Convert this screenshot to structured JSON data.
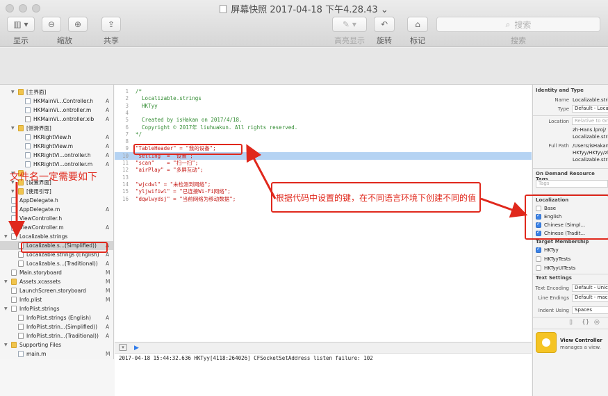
{
  "window": {
    "title": "屏幕快照 2017-04-18 下午4.28.43",
    "title_chevron": "⌄"
  },
  "toolbar": {
    "view_label": "显示",
    "zoom_label": "缩放",
    "share_label": "共享",
    "markup_label": "高亮显示",
    "rotate_label": "旋转",
    "tag_label": "标记",
    "search_label": "搜索",
    "search_placeholder": "搜索"
  },
  "navigator": {
    "rows": [
      {
        "label": "[主界面]",
        "badge": "",
        "kind": "folder",
        "indent": 2
      },
      {
        "label": "HKMainVi...Controller.h",
        "badge": "A",
        "kind": "h",
        "indent": 3
      },
      {
        "label": "HKMainVi...ontroller.m",
        "badge": "A",
        "kind": "m",
        "indent": 3
      },
      {
        "label": "HKMainVi...ontroller.xib",
        "badge": "A",
        "kind": "xib",
        "indent": 3
      },
      {
        "label": "[侧滑界面]",
        "badge": "",
        "kind": "folder",
        "indent": 2
      },
      {
        "label": "HKRightView.h",
        "badge": "A",
        "kind": "h",
        "indent": 3
      },
      {
        "label": "HKRightView.m",
        "badge": "A",
        "kind": "m",
        "indent": 3
      },
      {
        "label": "HKRightVi...ontroller.h",
        "badge": "A",
        "kind": "h",
        "indent": 3
      },
      {
        "label": "HKRightVi...ontroller.m",
        "badge": "A",
        "kind": "m",
        "indent": 3
      },
      {
        "label": "",
        "badge": "",
        "kind": "folder",
        "indent": 2
      },
      {
        "label": "[设置界面]",
        "badge": "",
        "kind": "folder",
        "indent": 2
      },
      {
        "label": "[使用引导]",
        "badge": "",
        "kind": "folder",
        "indent": 2
      },
      {
        "label": "AppDelegate.h",
        "badge": "",
        "kind": "h",
        "indent": 1
      },
      {
        "label": "AppDelegate.m",
        "badge": "A",
        "kind": "m",
        "indent": 1
      },
      {
        "label": "ViewController.h",
        "badge": "",
        "kind": "h",
        "indent": 1
      },
      {
        "label": "ViewController.m",
        "badge": "A",
        "kind": "m",
        "indent": 1
      },
      {
        "label": "Localizable.strings",
        "badge": "",
        "kind": "strings",
        "indent": 1
      },
      {
        "label": "Localizable.s...(Simplified))",
        "badge": "A",
        "kind": "strings",
        "indent": 2
      },
      {
        "label": "Localizable.strings (English)",
        "badge": "A",
        "kind": "strings",
        "indent": 2
      },
      {
        "label": "Localizable.s...(Traditional))",
        "badge": "A",
        "kind": "strings",
        "indent": 2
      },
      {
        "label": "Main.storyboard",
        "badge": "M",
        "kind": "storyboard",
        "indent": 1
      },
      {
        "label": "Assets.xcassets",
        "badge": "M",
        "kind": "folder",
        "indent": 1
      },
      {
        "label": "LaunchScreen.storyboard",
        "badge": "M",
        "kind": "storyboard",
        "indent": 1
      },
      {
        "label": "Info.plist",
        "badge": "M",
        "kind": "plist",
        "indent": 1
      },
      {
        "label": "InfoPlist.strings",
        "badge": "",
        "kind": "strings",
        "indent": 1
      },
      {
        "label": "InfoPlist.strings (English)",
        "badge": "A",
        "kind": "strings",
        "indent": 2
      },
      {
        "label": "InfoPlist.strin...(Simplified))",
        "badge": "A",
        "kind": "strings",
        "indent": 2
      },
      {
        "label": "InfoPlist.strin...(Traditional))",
        "badge": "A",
        "kind": "strings",
        "indent": 2
      },
      {
        "label": "Supporting Files",
        "badge": "",
        "kind": "folder",
        "indent": 1
      },
      {
        "label": "main.m",
        "badge": "M",
        "kind": "m",
        "indent": 2
      }
    ]
  },
  "editor": {
    "lines": [
      {
        "n": "1",
        "text": "/*",
        "style": "comment"
      },
      {
        "n": "2",
        "text": "  Localizable.strings",
        "style": "comment"
      },
      {
        "n": "3",
        "text": "  HKTyy",
        "style": "comment"
      },
      {
        "n": "4",
        "text": "",
        "style": "comment"
      },
      {
        "n": "5",
        "text": "  Created by isHakan on 2017/4/18.",
        "style": "comment"
      },
      {
        "n": "6",
        "text": "  Copyright © 2017年 liuhuakun. All rights reserved.",
        "style": "comment"
      },
      {
        "n": "7",
        "text": "*/",
        "style": "comment"
      },
      {
        "n": "8",
        "text": "",
        "style": "plain"
      },
      {
        "n": "9",
        "text": "\"TableHeader\" = \"我的设备\";",
        "style": "str"
      },
      {
        "n": "10",
        "text": "\"setting\" = \"设置\";",
        "style": "str"
      },
      {
        "n": "11",
        "text": "\"scan\"    = \"扫一扫\";",
        "style": "str"
      },
      {
        "n": "12",
        "text": "\"airPlay\" = \"多屏互动\";",
        "style": "str"
      },
      {
        "n": "13",
        "text": "",
        "style": "plain"
      },
      {
        "n": "14",
        "text": "\"wjcdwl\" = \"未检测到网络\";",
        "style": "str"
      },
      {
        "n": "15",
        "text": "\"yljwifiwl\" = \"已连接Wi-Fi网络\";",
        "style": "str"
      },
      {
        "n": "16",
        "text": "\"dqwlwydsj\" = \"当前网络为移动数据\";",
        "style": "str"
      }
    ]
  },
  "console": {
    "text": "2017-04-18 15:44:32.636 HKTyy[4118:264026] CFSocketSetAddress listen failure: 102"
  },
  "inspector": {
    "identity_title": "Identity and Type",
    "name_key": "Name",
    "name_val": "Localizable.strings",
    "type_key": "Type",
    "type_val": "Default - Localizable",
    "location_key": "Location",
    "location_val": "Relative to Group",
    "location_path1": "zh-Hans.lproj/",
    "location_path2": "Localizable.strings",
    "fullpath_key": "Full Path",
    "fullpath_1": "/Users/isHakan/",
    "fullpath_2": "HKTyy/HKTyy/zh-",
    "fullpath_3": "Localizable.strings",
    "odr_title": "On Demand Resource Tags",
    "tags_placeholder": "Tags",
    "localization_title": "Localization",
    "loc_base": "Base",
    "loc_english": "English",
    "loc_simplified": "Chinese (Simpl...",
    "loc_traditional": "Chinese (Tradit...",
    "target_title": "Target Membership",
    "target_1": "HKTyy",
    "target_2": "HKTyyTests",
    "target_3": "HKTyyUITests",
    "text_settings_title": "Text Settings",
    "encoding_key": "Text Encoding",
    "encoding_val": "Default - Unicode",
    "endings_key": "Line Endings",
    "endings_val": "Default - macOS",
    "indent_key": "Indent Using",
    "indent_val": "Spaces",
    "lib_title": "View Controller",
    "lib_desc": "manages a view."
  },
  "annotations": {
    "side_note": "文件名一定需要如下",
    "callout": "根据代码中设置的键，在不同语言环境下创建不同的值",
    "accent": "#e0281c"
  }
}
